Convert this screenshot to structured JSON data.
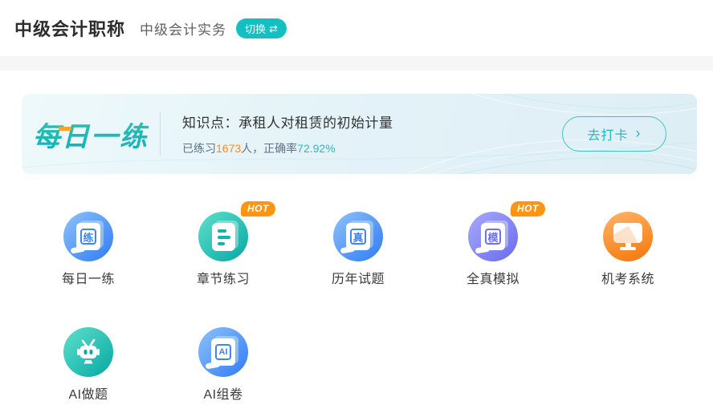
{
  "header": {
    "title": "中级会计职称",
    "subject": "中级会计实务",
    "switch_label": "切换",
    "switch_icon": "⇄"
  },
  "daily_banner": {
    "logo": "每日一练",
    "knowledge_label": "知识点：承租人对租赁的初始计量",
    "stats": {
      "prefix": "已练习",
      "practiced_count": "1673",
      "middle": "人，正确率",
      "accuracy": "72.92%"
    },
    "cta_label": "去打卡",
    "cta_arrow": "›"
  },
  "grid": {
    "items": [
      {
        "label": "每日一练",
        "icon": "scroll-icon",
        "char": "练",
        "theme": "blue"
      },
      {
        "label": "章节练习",
        "icon": "document-icon",
        "theme": "teal",
        "badge": "HOT"
      },
      {
        "label": "历年试题",
        "icon": "scroll-icon",
        "char": "真",
        "theme": "blue"
      },
      {
        "label": "全真模拟",
        "icon": "scroll-icon",
        "char": "模",
        "theme": "purple",
        "badge": "HOT"
      },
      {
        "label": "机考系统",
        "icon": "monitor-icon",
        "theme": "orange"
      },
      {
        "label": "AI做题",
        "icon": "robot-icon",
        "theme": "teal"
      },
      {
        "label": "AI组卷",
        "icon": "scroll-icon",
        "char": "AI",
        "theme": "blue"
      }
    ]
  },
  "colors": {
    "brand_teal": "#13bfc1",
    "cta_teal": "#2ab6c1",
    "logo_teal": "#1cb7b0",
    "logo_accent_orange": "#ffa226",
    "hot_orange": "#ff9415",
    "count_orange": "#ff8a1e",
    "accuracy_teal": "#2ab9c5",
    "icon_blue": "#3e86f6",
    "icon_teal": "#0fafa8",
    "icon_purple": "#6f72ee",
    "icon_orange": "#f67d13",
    "banner_bg": "#e4f3f8"
  }
}
